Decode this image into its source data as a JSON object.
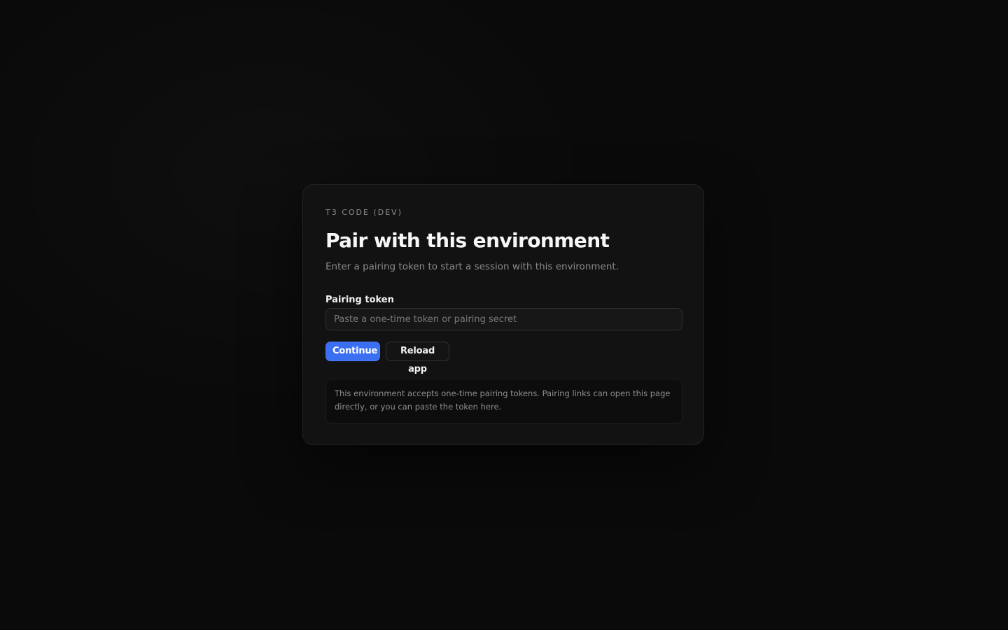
{
  "card": {
    "eyebrow": "T3 CODE (DEV)",
    "title": "Pair with this environment",
    "subtitle": "Enter a pairing token to start a session with this environment."
  },
  "form": {
    "token_label": "Pairing token",
    "token_value": "",
    "token_placeholder": "Paste a one-time token or pairing secret"
  },
  "actions": {
    "continue_label": "Continue",
    "reload_label": "Reload app"
  },
  "note": {
    "text": "This environment accepts one-time pairing tokens. Pairing links can open this page directly, or you can paste the token here."
  },
  "colors": {
    "accent": "#3b6ff2",
    "background": "#0a0a0a",
    "card": "#121212"
  }
}
